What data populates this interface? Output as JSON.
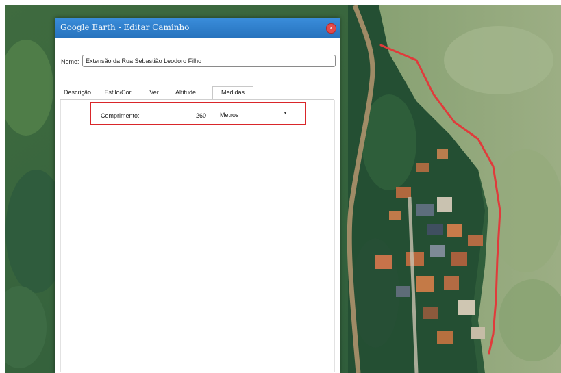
{
  "dialog": {
    "title": "Google Earth - Editar Caminho",
    "close_glyph": "×",
    "name_label": "Nome:",
    "name_value": "Extensão da Rua Sebastião Leodoro Filho"
  },
  "tabs": [
    {
      "label": "Descrição",
      "active": false
    },
    {
      "label": "Estilo/Cor",
      "active": false
    },
    {
      "label": "Ver",
      "active": false
    },
    {
      "label": "Altitude",
      "active": false
    },
    {
      "label": "Medidas",
      "active": true
    }
  ],
  "measures": {
    "length_label": "Comprimento:",
    "length_value": "260",
    "unit": "Metros"
  },
  "icons": {
    "close": "close-icon",
    "dropdown": "chevron-down-icon"
  },
  "colors": {
    "titlebar": "#2a7ecb",
    "path_line": "#e03b3b",
    "highlight": "#d9262a"
  }
}
